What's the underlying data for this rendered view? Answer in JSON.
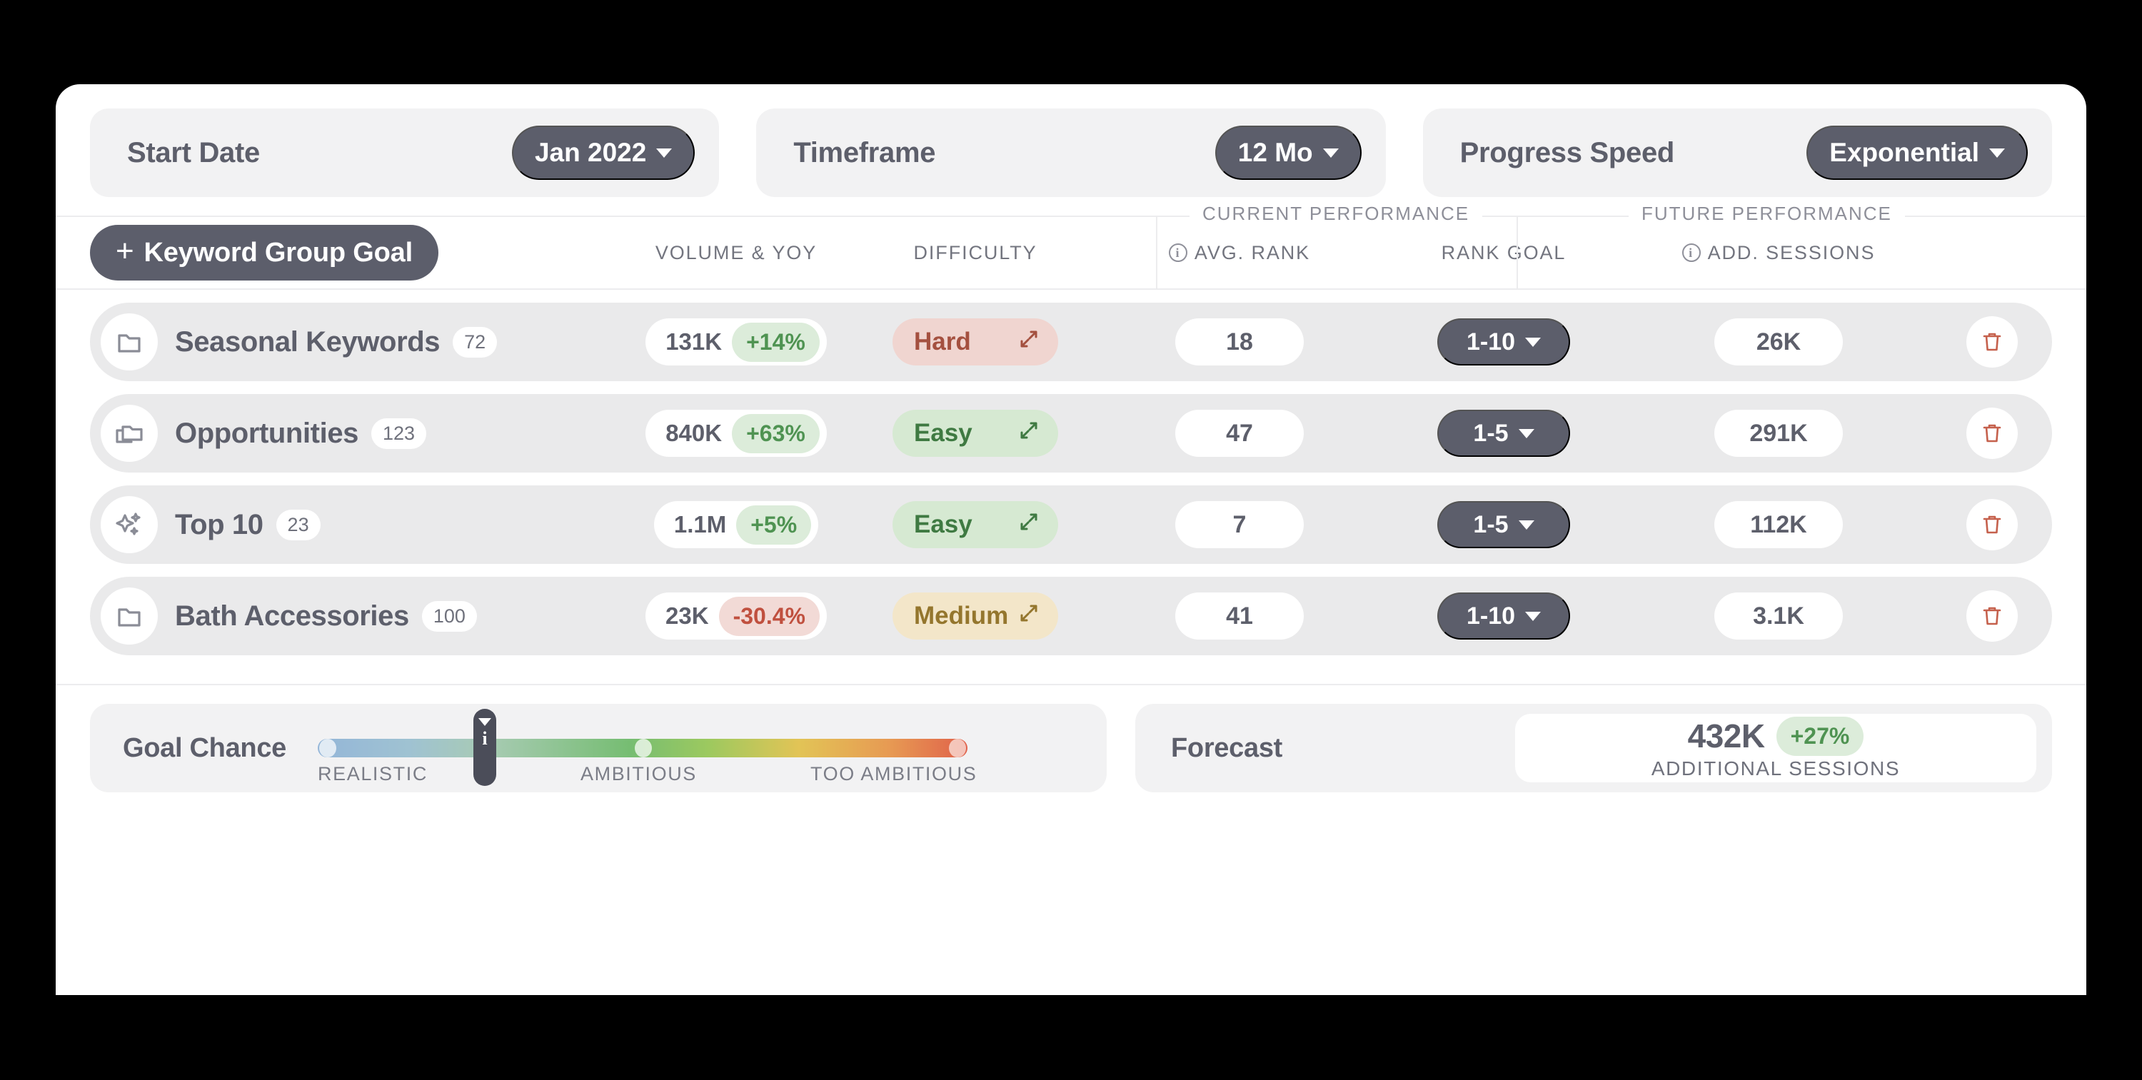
{
  "controls": [
    {
      "label": "Start Date",
      "value": "Jan 2022"
    },
    {
      "label": "Timeframe",
      "value": "12 Mo"
    },
    {
      "label": "Progress Speed",
      "value": "Exponential"
    }
  ],
  "table": {
    "add_button": "Keyword Group Goal",
    "add_plus": "+",
    "group_headers": {
      "current": "CURRENT PERFORMANCE",
      "future": "FUTURE PERFORMANCE"
    },
    "columns": {
      "volume": "VOLUME & YOY",
      "difficulty": "DIFFICULTY",
      "avg_rank": "AVG. RANK",
      "rank_goal": "RANK GOAL",
      "add_sessions": "ADD. SESSIONS"
    },
    "rows": [
      {
        "icon": "folder-icon",
        "name": "Seasonal Keywords",
        "count": "72",
        "volume": "131K",
        "delta": "+14%",
        "delta_sign": "pos",
        "difficulty": "Hard",
        "difficulty_level": "hard",
        "avg_rank": "18",
        "rank_goal": "1-10",
        "add_sessions": "26K"
      },
      {
        "icon": "folders-icon",
        "name": "Opportunities",
        "count": "123",
        "volume": "840K",
        "delta": "+63%",
        "delta_sign": "pos",
        "difficulty": "Easy",
        "difficulty_level": "easy",
        "avg_rank": "47",
        "rank_goal": "1-5",
        "add_sessions": "291K"
      },
      {
        "icon": "sparkles-icon",
        "name": "Top 10",
        "count": "23",
        "volume": "1.1M",
        "delta": "+5%",
        "delta_sign": "pos",
        "difficulty": "Easy",
        "difficulty_level": "easy",
        "avg_rank": "7",
        "rank_goal": "1-5",
        "add_sessions": "112K"
      },
      {
        "icon": "folder-icon",
        "name": "Bath Accessories",
        "count": "100",
        "volume": "23K",
        "delta": "-30.4%",
        "delta_sign": "neg",
        "difficulty": "Medium",
        "difficulty_level": "medium",
        "avg_rank": "41",
        "rank_goal": "1-10",
        "add_sessions": "3.1K"
      }
    ]
  },
  "footer": {
    "goal_chance": {
      "label": "Goal Chance",
      "scale": [
        "REALISTIC",
        "AMBITIOUS",
        "TOO AMBITIOUS"
      ]
    },
    "forecast": {
      "label": "Forecast",
      "value": "432K",
      "delta": "+27%",
      "caption": "ADDITIONAL  SESSIONS"
    }
  },
  "colors": {
    "dark": "#5c5e6b",
    "positive": "#4f9352",
    "negative": "#c0503f",
    "delete": "#c5604c",
    "card_bg": "#ffffff",
    "row_bg": "#eaeaeb",
    "chip_bg": "#f2f2f3"
  }
}
